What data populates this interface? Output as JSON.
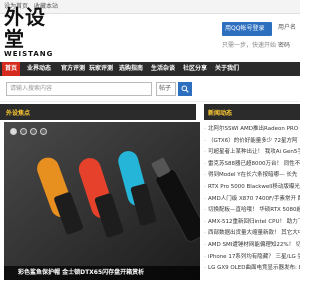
{
  "topbar": {
    "set_home": "设为首页",
    "favorite": "收藏本站"
  },
  "header": {
    "logo_cn": "外设堂",
    "logo_en": "WEISTANG",
    "login_label": "用QQ帐号登录",
    "sub_text": "只需一步，快速开始",
    "user_name": "用户名",
    "password": "密码"
  },
  "nav": {
    "items": [
      {
        "label": "首页",
        "active": true
      },
      {
        "label": "业界动态",
        "active": false
      },
      {
        "label": "官方评测",
        "active": false
      },
      {
        "label": "玩家评测",
        "active": false
      },
      {
        "label": "选购指南",
        "active": false
      },
      {
        "label": "生活杂谈",
        "active": false
      },
      {
        "label": "社区分享",
        "active": false
      },
      {
        "label": "关于我们",
        "active": false
      }
    ]
  },
  "search": {
    "placeholder": "请输入搜索内容",
    "select_value": "帖子"
  },
  "featured": {
    "title": "外设焦点",
    "caption": "彩色鲨鱼保护帽 金士顿DTX65闪存盘开箱赏析"
  },
  "news": {
    "title": "新闻动态",
    "items": [
      "北阿尔SSWI AMD推出Radeon PRO W",
      "（GTX6）的价好能量多少 72星方阿",
      "可超星者上某种出让！ 我攻Ai Gen5手机",
      "雷克苏S88器已超8000万台！ 同性不强",
      "得到Model Y在长六条按暗哪— 长先",
      "RTX Pro 5000 Blackwell移动版曝光置新",
      "AMD人门级 X870 7400F/手素常开 配",
      "切换配板—直哈哦！ 华硕RTX 5080超频",
      "AMX-512重新回归intel CPU！ 助力下代",
      "西部数据出货量大缩量新款！ 其它大中性",
      "AMD SMI遭锤材网能偏理知22%！ 切",
      "iPhone 17系列均有隐藏？ 三星/LG 强",
      "LG GX9 OLED曲面电竞显示器发布: 8"
    ]
  },
  "colors": {
    "nav_bg": "#2b2b2b",
    "accent_red": "#d52b1e",
    "accent_blue": "#2d6fbf",
    "section_title": "#ffcc33"
  }
}
